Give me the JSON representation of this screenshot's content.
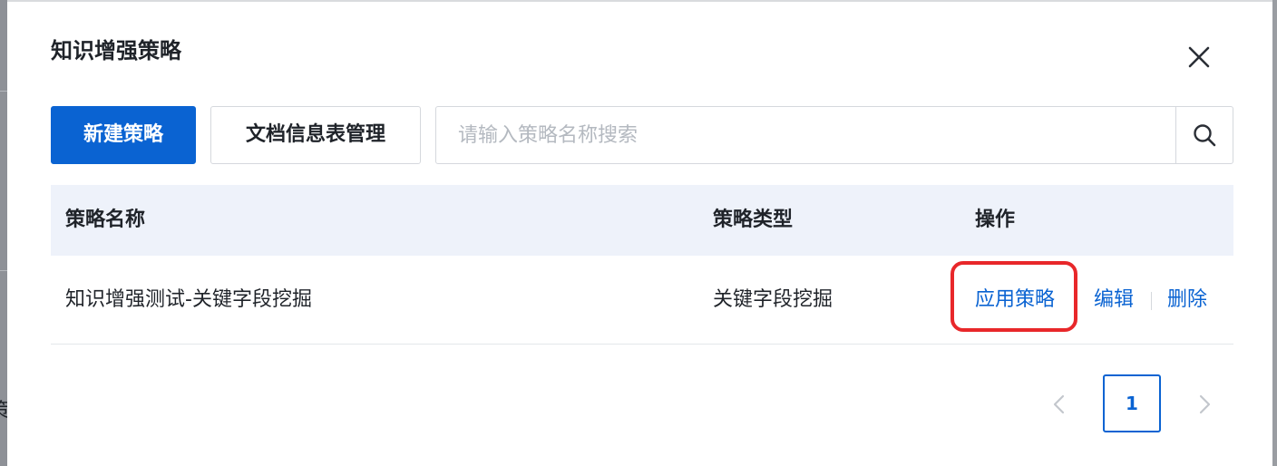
{
  "dialog": {
    "title": "知识增强策略",
    "close_icon": "close-icon"
  },
  "toolbar": {
    "new_label": "新建策略",
    "manage_label": "文档信息表管理"
  },
  "search": {
    "placeholder": "请输入策略名称搜索",
    "value": "",
    "icon": "search-icon"
  },
  "table": {
    "columns": [
      "策略名称",
      "策略类型",
      "操作"
    ],
    "rows": [
      {
        "name": "知识增强测试-关键字段挖掘",
        "type": "关键字段挖掘",
        "actions": [
          "应用策略",
          "编辑",
          "删除"
        ]
      }
    ]
  },
  "pagination": {
    "current_page": "1",
    "prev_icon": "chevron-left-icon",
    "next_icon": "chevron-right-icon"
  },
  "background": {
    "partial_text": "策"
  },
  "colors": {
    "primary": "#0a63d2",
    "highlight": "#e8272a",
    "header_bg": "#eef2fa"
  }
}
